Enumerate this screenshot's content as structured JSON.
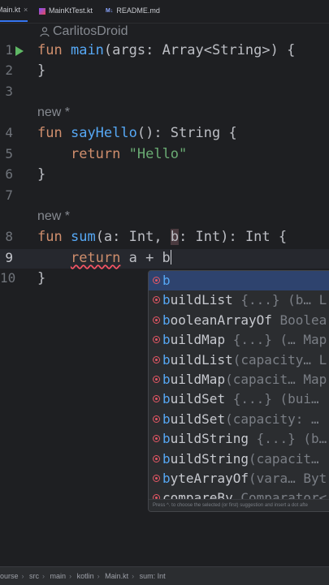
{
  "tabs": [
    {
      "label": "Main.kt",
      "icon": "kotlin-file-icon",
      "active": true,
      "close": "×"
    },
    {
      "label": "MainKtTest.kt",
      "icon": "kotlin-file-icon",
      "active": false
    },
    {
      "label": "README.md",
      "icon": "markdown-file-icon",
      "badge": "M↓",
      "active": false
    }
  ],
  "editor": {
    "author": "CarlitosDroid",
    "hint_new": "new *",
    "line_numbers": [
      "1",
      "2",
      "3",
      "4",
      "5",
      "6",
      "7",
      "8",
      "9",
      "10"
    ],
    "code": {
      "l1_kw": "fun",
      "l1_fn": "main",
      "l1_rest": "(args: Array<String>) {",
      "l2": "}",
      "l4_kw": "fun",
      "l4_fn": "sayHello",
      "l4_rest": "(): String {",
      "l5_kw": "return",
      "l5_str": "\"Hello\"",
      "l6": "}",
      "l8_kw": "fun",
      "l8_fn": "sum",
      "l8_a": "(a: Int, ",
      "l8_b": "b",
      "l8_rest": ": Int): Int {",
      "l9_kw": "return",
      "l9_rest": " a + b",
      "l10": "}"
    }
  },
  "completion": {
    "items": [
      {
        "match": "b",
        "rest": "",
        "sig": ""
      },
      {
        "match": "b",
        "rest": "uildList",
        "sig": " {...} (b… L"
      },
      {
        "match": "b",
        "rest": "ooleanArrayOf",
        "sig": " Boolea"
      },
      {
        "match": "b",
        "rest": "uildMap",
        "sig": " {...} (… Map"
      },
      {
        "match": "b",
        "rest": "uildList",
        "sig": "(capacity… L"
      },
      {
        "match": "b",
        "rest": "uildMap",
        "sig": "(capacit… Map"
      },
      {
        "match": "b",
        "rest": "uildSet",
        "sig": " {...} (bui…"
      },
      {
        "match": "b",
        "rest": "uildSet",
        "sig": "(capacity: …"
      },
      {
        "match": "b",
        "rest": "uildString",
        "sig": " {...} (b… L"
      },
      {
        "match": "b",
        "rest": "uildString",
        "sig": "(capacit…"
      },
      {
        "match": "b",
        "rest": "yteArrayOf",
        "sig": "(vara… Byt"
      },
      {
        "match": "",
        "rest": "compareBy",
        "sig": " Comparator<"
      }
    ],
    "footer": "Press ^. to choose the selected (or first) suggestion and insert a dot afte"
  },
  "status_bar": {
    "breadcrumbs": [
      "ourse",
      "src",
      "main",
      "kotlin",
      "Main.kt",
      "sum: Int"
    ]
  },
  "colors": {
    "keyword": "#cf8e6d",
    "function": "#56a8f5",
    "string": "#6aab73",
    "selection": "#2e436e",
    "run": "#5fb865"
  }
}
